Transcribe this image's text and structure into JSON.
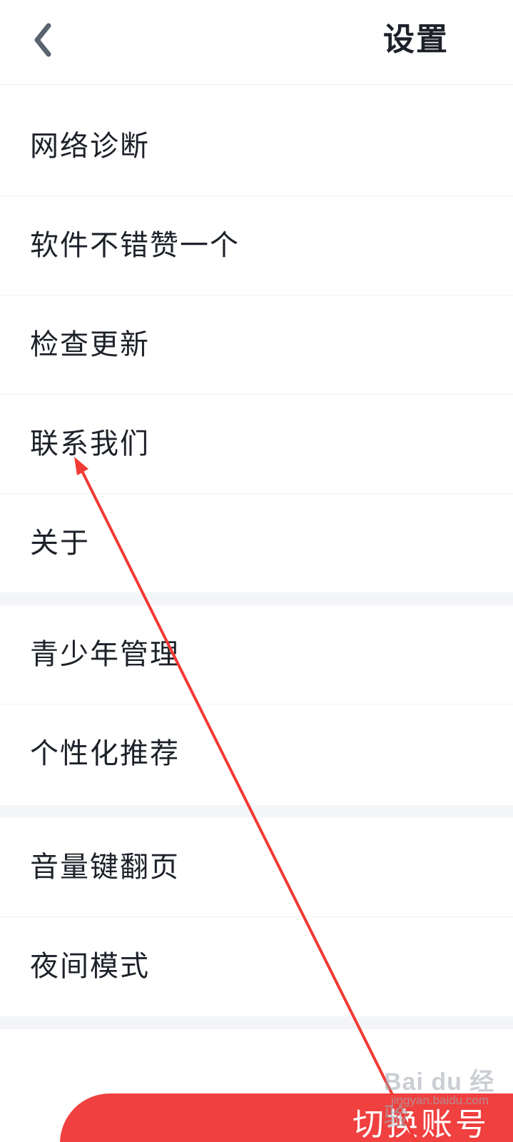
{
  "header": {
    "title": "设置",
    "back_icon": "chevron-left-icon"
  },
  "groups": [
    {
      "items": [
        {
          "label": "网络诊断"
        },
        {
          "label": "软件不错赞一个"
        },
        {
          "label": "检查更新"
        },
        {
          "label": "联系我们"
        },
        {
          "label": "关于"
        }
      ]
    },
    {
      "items": [
        {
          "label": "青少年管理"
        },
        {
          "label": "个性化推荐"
        }
      ]
    },
    {
      "items": [
        {
          "label": "音量键翻页"
        },
        {
          "label": "夜间模式"
        }
      ]
    }
  ],
  "bottom_button": {
    "label": "切换账号"
  },
  "watermark": {
    "logo": "Bai du 经验",
    "url": "jingyan.baidu.com"
  },
  "colors": {
    "accent": "#f0403f",
    "text": "#1d2129",
    "divider": "#f0f1f4",
    "gap": "#f4f5f8",
    "annotation_arrow": "#f23a34"
  }
}
